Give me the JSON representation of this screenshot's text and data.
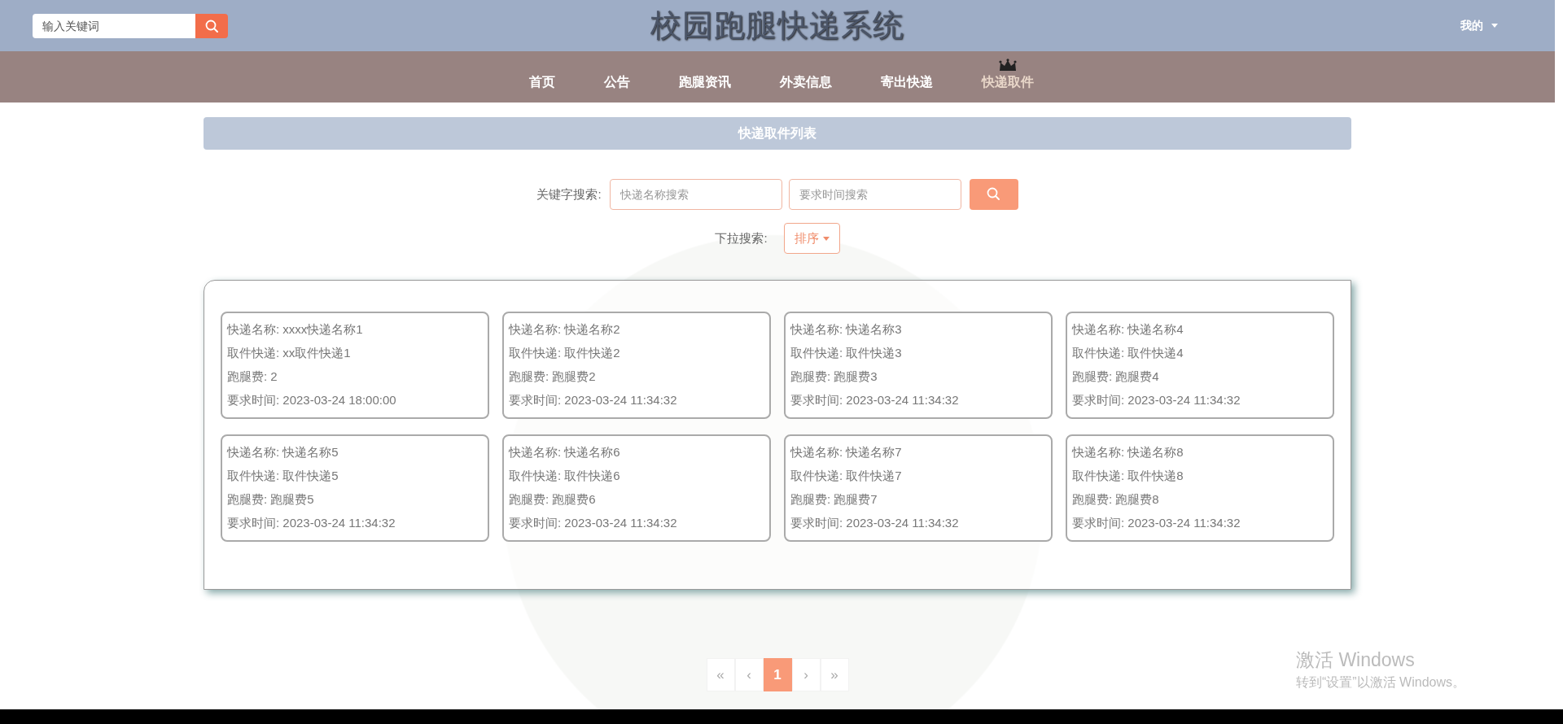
{
  "header": {
    "search": {
      "placeholder": "输入关键词"
    },
    "title": "校园跑腿快递系统",
    "user_menu": "我的"
  },
  "nav": [
    {
      "label": "首页",
      "selected": false
    },
    {
      "label": "公告",
      "selected": false
    },
    {
      "label": "跑腿资讯",
      "selected": false
    },
    {
      "label": "外卖信息",
      "selected": false
    },
    {
      "label": "寄出快递",
      "selected": false
    },
    {
      "label": "快递取件",
      "selected": true
    }
  ],
  "section_title": "快递取件列表",
  "filters": {
    "keyword_label": "关键字搜索:",
    "fields": [
      {
        "placeholder": "快递名称搜索"
      },
      {
        "placeholder": "要求时间搜索"
      }
    ],
    "dropdown_label": "下拉搜索:",
    "dropdown": "排序"
  },
  "cards": [
    {
      "lines": [
        {
          "label": "快递名称:",
          "value": "xxxx快递名称1"
        },
        {
          "label": "取件快递:",
          "value": "xx取件快递1"
        },
        {
          "label": "跑腿费:",
          "value": "2"
        },
        {
          "label": "要求时间:",
          "value": "2023-03-24 18:00:00"
        }
      ]
    },
    {
      "lines": [
        {
          "label": "快递名称:",
          "value": "快递名称2"
        },
        {
          "label": "取件快递:",
          "value": "取件快递2"
        },
        {
          "label": "跑腿费:",
          "value": "跑腿费2"
        },
        {
          "label": "要求时间:",
          "value": "2023-03-24 11:34:32"
        }
      ]
    },
    {
      "lines": [
        {
          "label": "快递名称:",
          "value": "快递名称3"
        },
        {
          "label": "取件快递:",
          "value": "取件快递3"
        },
        {
          "label": "跑腿费:",
          "value": "跑腿费3"
        },
        {
          "label": "要求时间:",
          "value": "2023-03-24 11:34:32"
        }
      ]
    },
    {
      "lines": [
        {
          "label": "快递名称:",
          "value": "快递名称4"
        },
        {
          "label": "取件快递:",
          "value": "取件快递4"
        },
        {
          "label": "跑腿费:",
          "value": "跑腿费4"
        },
        {
          "label": "要求时间:",
          "value": "2023-03-24 11:34:32"
        }
      ]
    },
    {
      "lines": [
        {
          "label": "快递名称:",
          "value": "快递名称5"
        },
        {
          "label": "取件快递:",
          "value": "取件快递5"
        },
        {
          "label": "跑腿费:",
          "value": "跑腿费5"
        },
        {
          "label": "要求时间:",
          "value": "2023-03-24 11:34:32"
        }
      ]
    },
    {
      "lines": [
        {
          "label": "快递名称:",
          "value": "快递名称6"
        },
        {
          "label": "取件快递:",
          "value": "取件快递6"
        },
        {
          "label": "跑腿费:",
          "value": "跑腿费6"
        },
        {
          "label": "要求时间:",
          "value": "2023-03-24 11:34:32"
        }
      ]
    },
    {
      "lines": [
        {
          "label": "快递名称:",
          "value": "快递名称7"
        },
        {
          "label": "取件快递:",
          "value": "取件快递7"
        },
        {
          "label": "跑腿费:",
          "value": "跑腿费7"
        },
        {
          "label": "要求时间:",
          "value": "2023-03-24 11:34:32"
        }
      ]
    },
    {
      "lines": [
        {
          "label": "快递名称:",
          "value": "快递名称8"
        },
        {
          "label": "取件快递:",
          "value": "取件快递8"
        },
        {
          "label": "跑腿费:",
          "value": "跑腿费8"
        },
        {
          "label": "要求时间:",
          "value": "2023-03-24 11:34:32"
        }
      ]
    }
  ],
  "pagination": [
    {
      "label": "«",
      "selected": false
    },
    {
      "label": "‹",
      "selected": false
    },
    {
      "label": "1",
      "selected": true
    },
    {
      "label": "›",
      "selected": false
    },
    {
      "label": "»",
      "selected": false
    }
  ],
  "os_notice": {
    "title": "激活 Windows",
    "subtitle": "转到“设置”以激活 Windows。"
  }
}
